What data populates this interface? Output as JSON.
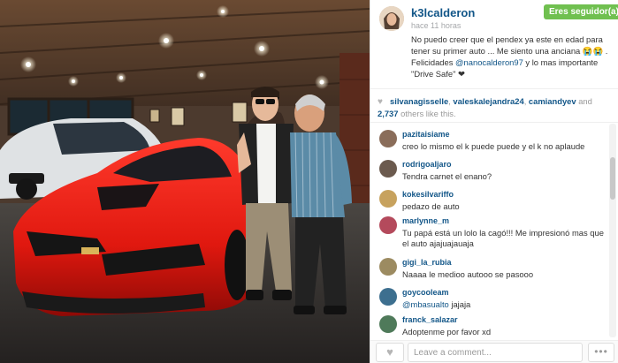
{
  "post": {
    "username": "k3lcalderon",
    "follow_label": "Eres seguidor(a)",
    "timestamp": "hace 11 horas",
    "caption_1": "No puedo creer que el pendex ya este en edad para tener su primer auto ... Me siento una anciana 😭😭 . Felicidades ",
    "caption_mention": "@nanocalderon97",
    "caption_2": " y lo mas importante \"Drive Safe\" ❤"
  },
  "likes": {
    "likers": [
      "silvanagisselle",
      "valeskalejandra24",
      "camiandyev"
    ],
    "sep_1": ", ",
    "sep_2": ", ",
    "and_text": " and ",
    "others_count": "2,737",
    "others_text": " others like this."
  },
  "comments": [
    {
      "user": "pazitaisiame",
      "text": "creo lo mismo el k puede puede y el k no aplaude",
      "avatar_color": "#8a6d5a"
    },
    {
      "user": "rodrigoaljaro",
      "text": "Tendra carnet el enano?",
      "avatar_color": "#6b5a4e"
    },
    {
      "user": "kokesilvariffo",
      "text": "pedazo de auto ",
      "avatar_color": "#c7a25e"
    },
    {
      "user": "marlynne_m",
      "text": "Tu papá está un lolo la cagó!!! Me impresionó mas que el auto ajajuajauaja",
      "avatar_color": "#b44a5c"
    },
    {
      "user": "gigi_la_rubia",
      "text": "Naaaa le medioo autooo se pasooo",
      "avatar_color": "#9c8b61"
    },
    {
      "user": "goycooleam",
      "mention": "@mbasualto",
      "text": " jajaja",
      "avatar_color": "#3d6f8f"
    },
    {
      "user": "franck_salazar",
      "text": "Adoptenme por favor xd",
      "avatar_color": "#4f7a5a"
    }
  ],
  "footer": {
    "comment_placeholder": "Leave a comment...",
    "more_label": "•••"
  },
  "icons": {
    "like": "heart-icon",
    "more": "more-options-icon"
  },
  "colors": {
    "link": "#125688",
    "follow_bg": "#70c050",
    "muted": "#a5a7aa"
  }
}
